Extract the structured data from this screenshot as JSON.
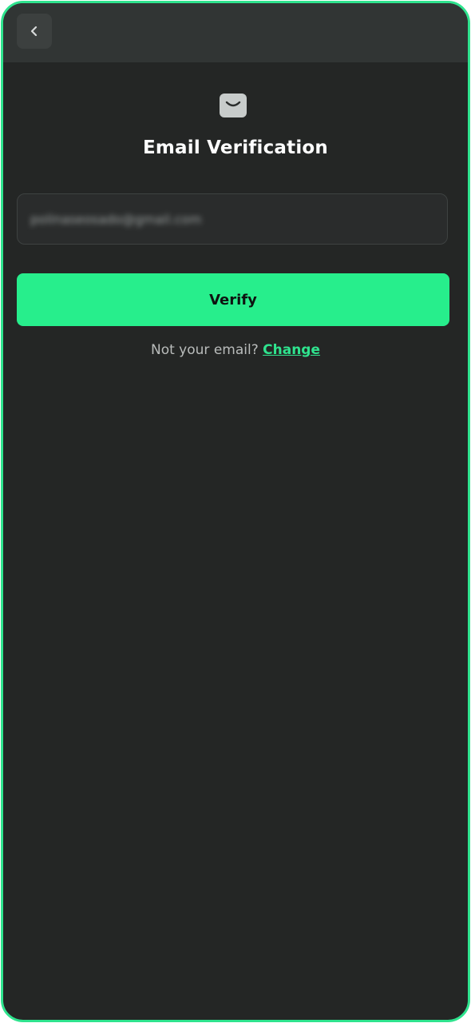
{
  "header": {
    "back_icon": "chevron-left-icon"
  },
  "hero": {
    "icon": "mail-icon",
    "title": "Email Verification"
  },
  "form": {
    "email_value": "polinaseosado@gmail.com",
    "verify_label": "Verify"
  },
  "footer": {
    "prompt": "Not your email?",
    "change_label": "Change"
  },
  "colors": {
    "accent": "#27ee8c",
    "background": "#242625",
    "border": "#2fe38e"
  }
}
